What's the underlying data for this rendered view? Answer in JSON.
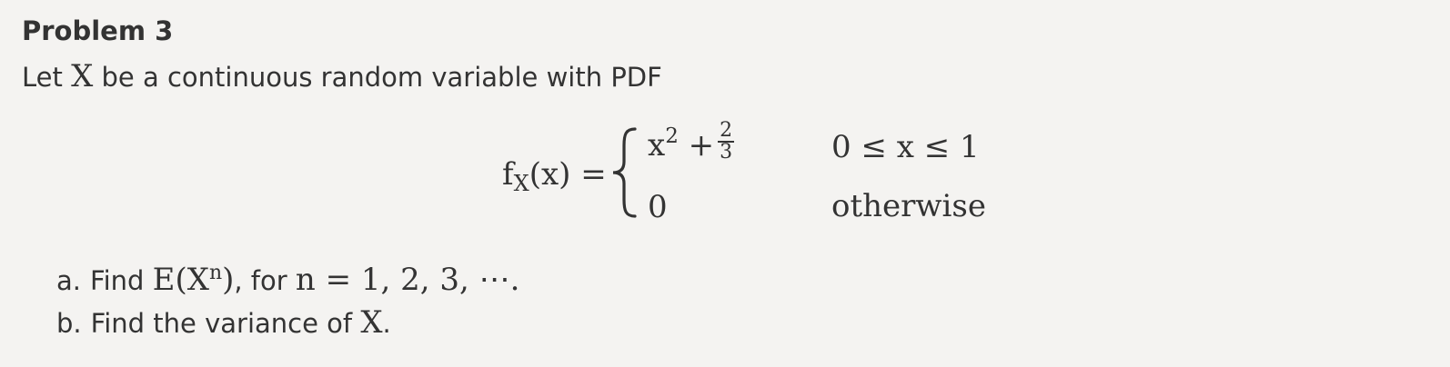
{
  "problem": {
    "title": "Problem 3",
    "intro": {
      "prefix": "Let",
      "var": "X",
      "suffix": "be a continuous random variable with PDF"
    }
  },
  "pdf": {
    "lhs_func": "f",
    "lhs_sub": "X",
    "lhs_arg": "(x) =",
    "case1_base": "x",
    "case1_exp": "2",
    "case1_plus": "+",
    "case1_frac_num": "2",
    "case1_frac_den": "3",
    "case1_condition": "0 ≤ x ≤ 1",
    "case2_value": "0",
    "case2_condition": "otherwise"
  },
  "questions": [
    {
      "label": "a.",
      "prefix": "Find",
      "expr_base": "E(X",
      "expr_exp": "n",
      "expr_close": ")",
      "middle": ", for",
      "math_tail": "n = 1, 2, 3, ⋯."
    },
    {
      "label": "b.",
      "prefix": "Find the variance of",
      "var": "X",
      "end": "."
    }
  ]
}
